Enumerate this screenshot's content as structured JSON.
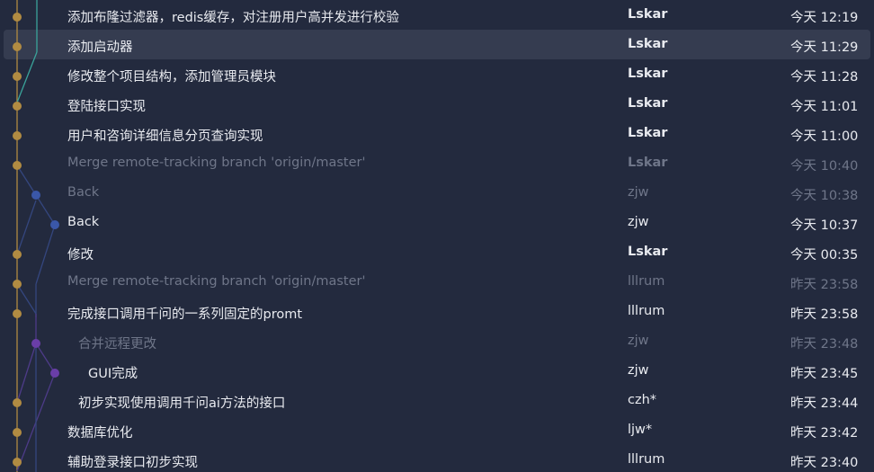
{
  "commits": [
    {
      "message": "添加布隆过滤器，redis缓存，对注册用户高并发进行校验",
      "author": "Lskar",
      "time": "今天 12:19",
      "author_bold": true,
      "dim": false,
      "selected": false,
      "indent": 0
    },
    {
      "message": "添加启动器",
      "author": "Lskar",
      "time": "今天 11:29",
      "author_bold": true,
      "dim": false,
      "selected": true,
      "indent": 0
    },
    {
      "message": "修改整个项目结构，添加管理员模块",
      "author": "Lskar",
      "time": "今天 11:28",
      "author_bold": true,
      "dim": false,
      "selected": false,
      "indent": 0
    },
    {
      "message": "登陆接口实现",
      "author": "Lskar",
      "time": "今天 11:01",
      "author_bold": true,
      "dim": false,
      "selected": false,
      "indent": 0
    },
    {
      "message": "用户和咨询详细信息分页查询实现",
      "author": "Lskar",
      "time": "今天 11:00",
      "author_bold": true,
      "dim": false,
      "selected": false,
      "indent": 0
    },
    {
      "message": "Merge remote-tracking branch 'origin/master'",
      "author": "Lskar",
      "time": "今天 10:40",
      "author_bold": true,
      "dim": true,
      "selected": false,
      "indent": 0
    },
    {
      "message": "Back",
      "author": "zjw",
      "time": "今天 10:38",
      "author_bold": false,
      "dim": true,
      "selected": false,
      "indent": 0
    },
    {
      "message": "Back",
      "author": "zjw",
      "time": "今天 10:37",
      "author_bold": false,
      "dim": false,
      "selected": false,
      "indent": 0
    },
    {
      "message": "修改",
      "author": "Lskar",
      "time": "今天 00:35",
      "author_bold": true,
      "dim": false,
      "selected": false,
      "indent": 0
    },
    {
      "message": "Merge remote-tracking branch 'origin/master'",
      "author": "lllrum",
      "time": "昨天 23:58",
      "author_bold": false,
      "dim": true,
      "selected": false,
      "indent": 0
    },
    {
      "message": "完成接口调用千问的一系列固定的promt",
      "author": "lllrum",
      "time": "昨天 23:58",
      "author_bold": false,
      "dim": false,
      "selected": false,
      "indent": 0
    },
    {
      "message": "合并远程更改",
      "author": "zjw",
      "time": "昨天 23:48",
      "author_bold": false,
      "dim": true,
      "selected": false,
      "indent": 1
    },
    {
      "message": "GUI完成",
      "author": "zjw",
      "time": "昨天 23:45",
      "author_bold": false,
      "dim": false,
      "selected": false,
      "indent": 2
    },
    {
      "message": "初步实现使用调用千问ai方法的接口",
      "author": "czh*",
      "time": "昨天 23:44",
      "author_bold": false,
      "dim": false,
      "selected": false,
      "indent": 1
    },
    {
      "message": "数据库优化",
      "author": "ljw*",
      "time": "昨天 23:42",
      "author_bold": false,
      "dim": false,
      "selected": false,
      "indent": 0
    },
    {
      "message": "辅助登录接口初步实现",
      "author": "lllrum",
      "time": "昨天 23:40",
      "author_bold": false,
      "dim": false,
      "selected": false,
      "indent": 0
    }
  ],
  "colors": {
    "background": "#232a3e",
    "selected_row": "#353c50",
    "node_gold": "#b18b42",
    "node_blue": "#3a57a8",
    "node_purple": "#6a3ea8",
    "line_teal": "#3aa39a",
    "line_blue": "#34467e",
    "line_purple": "#4d3b88",
    "text": "#e9ebf0",
    "text_dim": "#6f7689"
  }
}
